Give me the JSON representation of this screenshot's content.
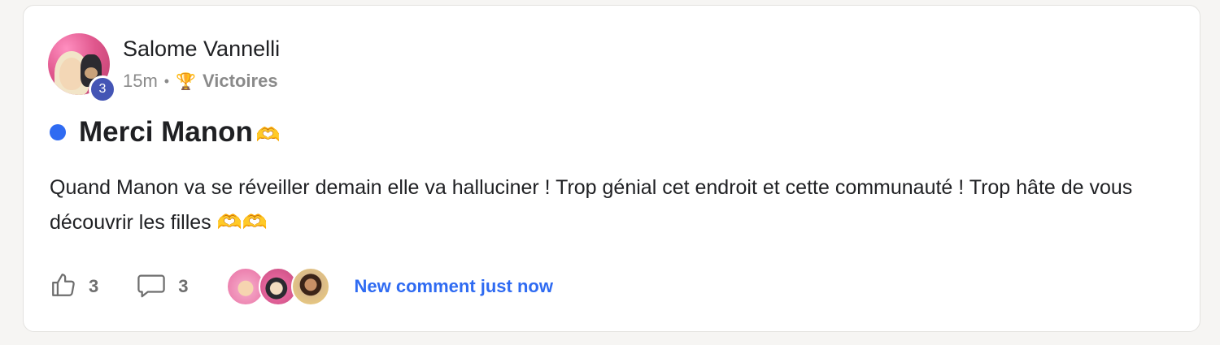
{
  "author": {
    "name": "Salome Vannelli",
    "level": "3"
  },
  "meta": {
    "time": "15m",
    "separator": "•",
    "category_icon": "🏆",
    "category": "Victoires"
  },
  "post": {
    "title": "Merci Manon",
    "title_emoji": "🫶",
    "body": "Quand Manon va se réveiller demain elle va halluciner ! Trop génial cet endroit et cette communauté ! Trop hâte de vous découvrir les filles 🫶🫶"
  },
  "actions": {
    "likes": "3",
    "comments": "3",
    "new_comment": "New comment just now"
  },
  "colors": {
    "accent": "#2f6bf2",
    "level_badge": "#4455b5",
    "unread_dot": "#2f6bf2"
  },
  "icons": {
    "like": "thumbs-up-icon",
    "comment": "comment-bubble-icon",
    "trophy": "trophy-icon"
  }
}
